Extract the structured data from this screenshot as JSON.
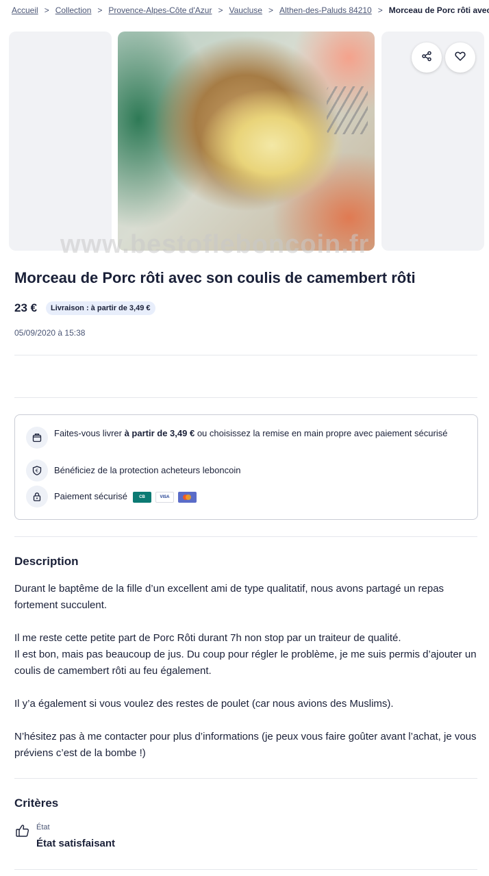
{
  "breadcrumb": {
    "items": [
      "Accueil",
      "Collection",
      "Provence-Alpes-Côte d'Azur",
      "Vaucluse",
      "Althen-des-Paluds 84210"
    ],
    "separator": ">",
    "current": "Morceau de Porc rôti avec s"
  },
  "gallery": {
    "watermark": "www.bestofleboncoin.fr",
    "share_icon": "share-icon",
    "favorite_icon": "heart-icon"
  },
  "ad": {
    "title": "Morceau de Porc rôti avec son coulis de camembert rôti",
    "price": "23 €",
    "delivery_badge": "Livraison : à partir de 3,49 €",
    "date": "05/09/2020 à 15:38"
  },
  "info": {
    "delivery_pre": "Faites-vous livrer ",
    "delivery_bold": "à partir de 3,49 €",
    "delivery_post": " ou choisissez la remise en main propre avec paiement sécurisé",
    "protection": "Bénéficiez de la protection acheteurs leboncoin",
    "payment": "Paiement sécurisé",
    "cards": [
      "CB",
      "VISA",
      ""
    ]
  },
  "description": {
    "heading": "Description",
    "p1": "Durant le baptême de la fille d’un excellent ami de type qualitatif, nous avons partagé un repas fortement succulent.",
    "p2a": "Il me reste cette petite part de Porc Rôti durant 7h non stop par un traiteur de qualité.",
    "p2b": "Il est bon, mais pas beaucoup de jus. Du coup pour régler le problème, je me suis permis d’ajouter un coulis de camembert rôti au feu également.",
    "p3": "Il y’a également si vous voulez des restes de poulet (car nous avions des Muslims).",
    "p4": "N’hésitez pas à me contacter pour plus d’informations (je peux vous faire goûter avant l’achat, je vous préviens c’est de la bombe !)"
  },
  "criteria": {
    "heading": "Critères",
    "label": "État",
    "value": "État satisfaisant"
  },
  "colors": {
    "text": "#1a2038",
    "muted": "#4a5575",
    "badge_bg": "#e8eefb",
    "border": "#c9ccd5"
  }
}
